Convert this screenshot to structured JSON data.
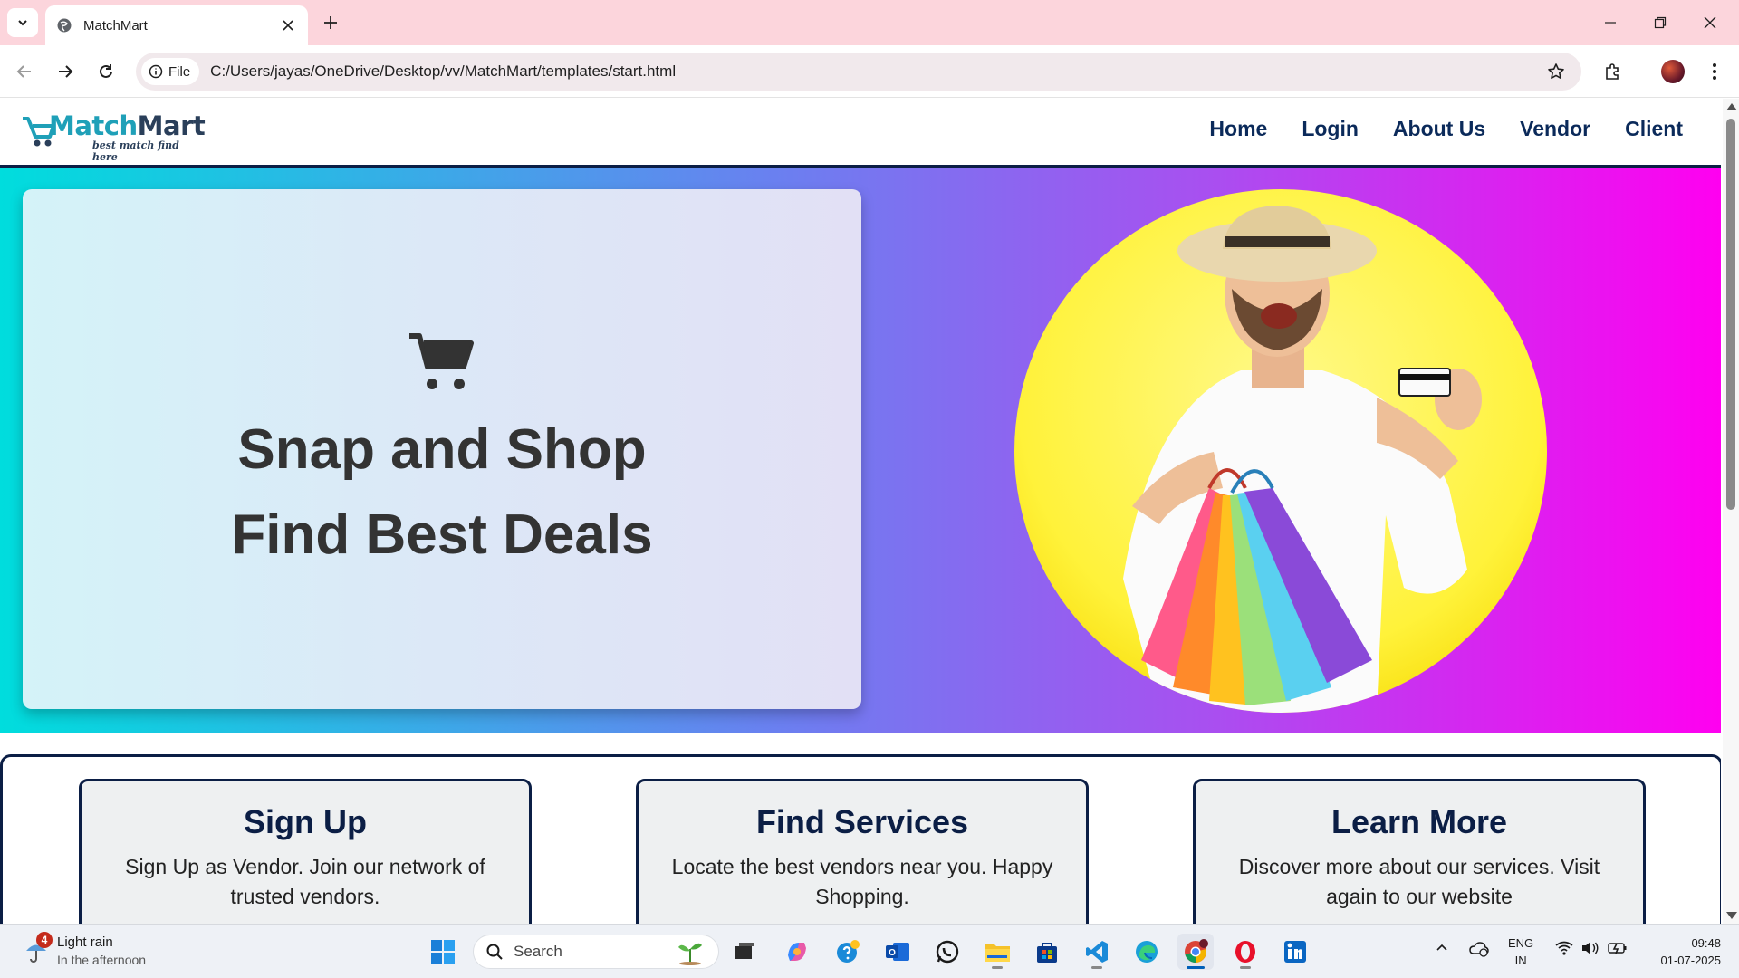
{
  "browser": {
    "tab_title": "MatchMart",
    "chip_label": "File",
    "url": "C:/Users/jayas/OneDrive/Desktop/vv/MatchMart/templates/start.html"
  },
  "site": {
    "logo_main": "Match",
    "logo_accent": "Mart",
    "logo_tagline": "best match find here",
    "nav": [
      "Home",
      "Login",
      "About Us",
      "Vendor",
      "Client"
    ]
  },
  "hero": {
    "line1": "Snap and Shop",
    "line2": "Find Best Deals"
  },
  "features": [
    {
      "title": "Sign Up",
      "text": "Sign Up as Vendor. Join our network of trusted vendors."
    },
    {
      "title": "Find Services",
      "text": "Locate the best vendors near you. Happy Shopping."
    },
    {
      "title": "Learn More",
      "text": "Discover more about our services. Visit again to our website"
    }
  ],
  "taskbar": {
    "weather_badge": "4",
    "weather_title": "Light rain",
    "weather_sub": "In the afternoon",
    "search_label": "Search",
    "lang_line1": "ENG",
    "lang_line2": "IN",
    "time": "09:48",
    "date": "01-07-2025"
  },
  "colors": {
    "tabbar": "#fcd5dc",
    "nav_text": "#0b2a5a",
    "hero_gradient_start": "#00dddd",
    "hero_gradient_end": "#ff00f0",
    "card_border": "#0b1e45"
  }
}
